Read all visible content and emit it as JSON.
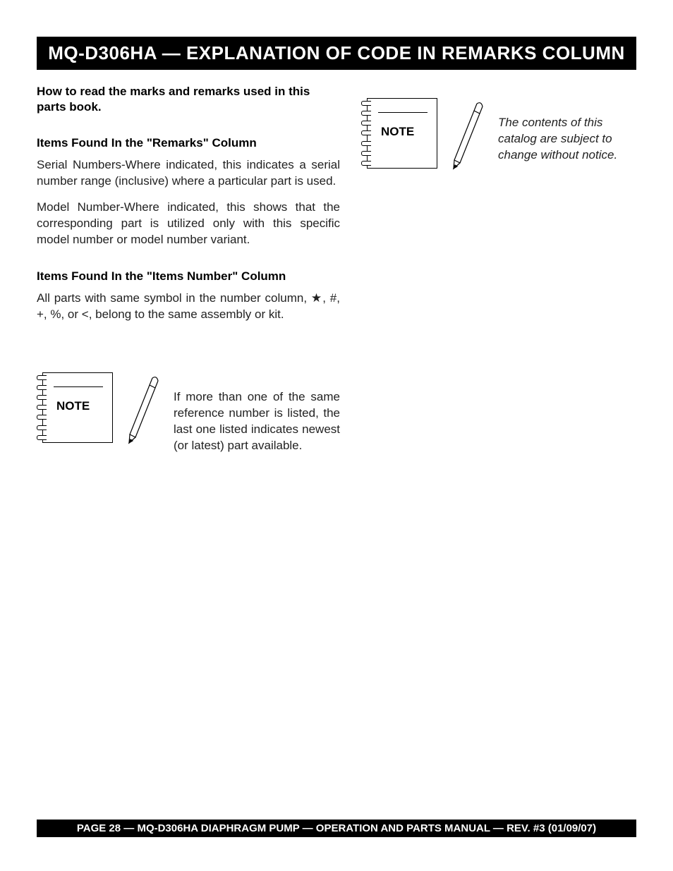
{
  "header": {
    "title": "MQ-D306HA —  EXPLANATION OF CODE IN REMARKS COLUMN"
  },
  "intro": "How to read the marks and remarks used in this parts book.",
  "remarks": {
    "heading": "Items Found In the \"Remarks\" Column",
    "para1": "Serial Numbers-Where indicated, this indicates a serial number range (inclusive) where a particular part is used.",
    "para2": "Model Number-Where indicated, this shows that the corresponding part is utilized only with this specific model number or model number variant."
  },
  "items_number": {
    "heading": "Items Found In the \"Items Number\" Column",
    "para": "All parts with same symbol in the number column, ★, #, +, %, or <, belong to the same assembly or kit."
  },
  "note_left": {
    "label": "NOTE",
    "text": "If more than one of the same reference number is listed, the last one listed indicates newest (or latest) part available."
  },
  "note_right": {
    "label": "NOTE",
    "text": "The contents of this catalog are subject to change without notice."
  },
  "footer": "PAGE 28 — MQ-D306HA DIAPHRAGM PUMP — OPERATION AND PARTS MANUAL — REV. #3  (01/09/07)"
}
